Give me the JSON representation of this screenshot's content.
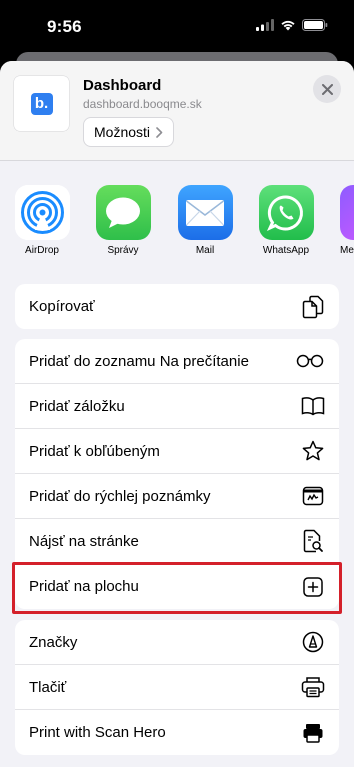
{
  "status_bar": {
    "time": "9:56"
  },
  "header": {
    "title": "Dashboard",
    "url": "dashboard.booqme.sk",
    "options_label": "Možnosti",
    "logo_letter": "b."
  },
  "apps": [
    {
      "label": "AirDrop",
      "icon": "airdrop-icon"
    },
    {
      "label": "Správy",
      "icon": "messages-icon"
    },
    {
      "label": "Mail",
      "icon": "mail-icon"
    },
    {
      "label": "WhatsApp",
      "icon": "whatsapp-icon"
    },
    {
      "label": "Me",
      "icon": "more-app-icon"
    }
  ],
  "actions_group1": [
    {
      "label": "Kopírovať",
      "icon": "copy-icon"
    }
  ],
  "actions_group2": [
    {
      "label": "Pridať do zoznamu Na prečítanie",
      "icon": "glasses-icon"
    },
    {
      "label": "Pridať záložku",
      "icon": "book-icon"
    },
    {
      "label": "Pridať k obľúbeným",
      "icon": "star-icon"
    },
    {
      "label": "Pridať do rýchlej poznámky",
      "icon": "quick-note-icon"
    },
    {
      "label": "Nájsť na stránke",
      "icon": "find-on-page-icon"
    },
    {
      "label": "Pridať na plochu",
      "icon": "add-square-icon"
    }
  ],
  "actions_group3": [
    {
      "label": "Značky",
      "icon": "markup-icon"
    },
    {
      "label": "Tlačiť",
      "icon": "printer-icon"
    },
    {
      "label": "Print with Scan Hero",
      "icon": "scan-hero-icon"
    }
  ],
  "colors": {
    "highlight": "#d4202a",
    "airdrop": "#1a8cff",
    "messages": "#34c759",
    "mail": "#1d7cf2",
    "whatsapp": "#25d366",
    "brand": "#2f7ff0"
  }
}
